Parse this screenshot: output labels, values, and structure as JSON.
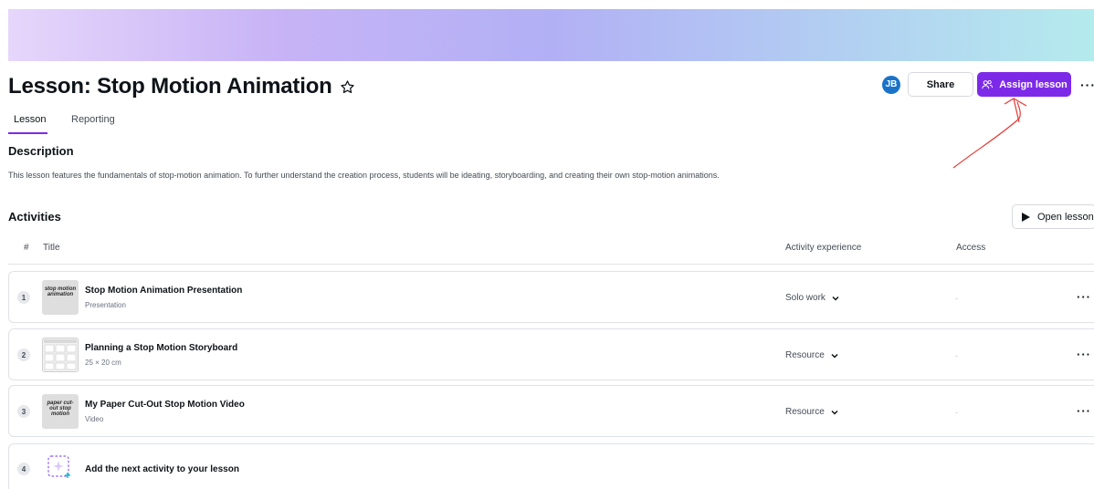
{
  "header": {
    "title": "Lesson: Stop Motion Animation",
    "avatar_initials": "JB",
    "share_label": "Share",
    "assign_label": "Assign lesson",
    "more_label": "···"
  },
  "tabs": [
    {
      "label": "Lesson",
      "active": true
    },
    {
      "label": "Reporting",
      "active": false
    }
  ],
  "description": {
    "heading": "Description",
    "text": "This lesson features the fundamentals of stop-motion animation. To further understand the creation process, students will be ideating, storyboarding, and creating their own stop-motion animations."
  },
  "activities": {
    "heading": "Activities",
    "open_lesson_label": "Open lesson",
    "columns": {
      "num": "#",
      "title": "Title",
      "experience": "Activity experience",
      "access": "Access"
    },
    "rows": [
      {
        "num": "1",
        "title": "Stop Motion Animation Presentation",
        "subtitle": "Presentation",
        "experience": "Solo work",
        "access": "-",
        "thumb_text": "stop motion animation"
      },
      {
        "num": "2",
        "title": "Planning a Stop Motion Storyboard",
        "subtitle": "25 × 20 cm",
        "experience": "Resource",
        "access": "-"
      },
      {
        "num": "3",
        "title": "My Paper Cut-Out Stop Motion Video",
        "subtitle": "Video",
        "experience": "Resource",
        "access": "-",
        "thumb_text": "paper cut-out stop motion"
      }
    ],
    "add_row": {
      "num": "4",
      "label": "Add the next activity to your lesson"
    },
    "row_more_label": "···"
  },
  "colors": {
    "accent": "#7d2ae8",
    "avatar": "#1a73c9",
    "annotation": "#e53935"
  }
}
